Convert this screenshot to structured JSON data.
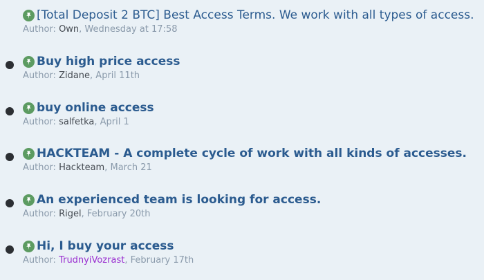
{
  "threads": [
    {
      "title": "[Total Deposit 2 BTC] Best Access Terms. We work with all types of access.",
      "author_prefix": "Author: ",
      "author": "Own",
      "date": ", Wednesday at 17:58",
      "unread": false
    },
    {
      "title": "Buy high price access",
      "author_prefix": "Author: ",
      "author": "Zidane",
      "date": ", April 11th",
      "unread": true
    },
    {
      "title": "buy online access",
      "author_prefix": "Author: ",
      "author": "salfetka",
      "date": ", April 1",
      "unread": true
    },
    {
      "title": "HACKTEAM - A complete cycle of work with all kinds of accesses.",
      "author_prefix": "Author: ",
      "author": "Hackteam",
      "date": ", March 21",
      "unread": true
    },
    {
      "title": "An experienced team is looking for access.",
      "author_prefix": "Author: ",
      "author": "Rigel",
      "date": ", February 20th",
      "unread": true
    },
    {
      "title": "Hi, I buy your access",
      "author_prefix": "Author: ",
      "author": "TrudnyiVozrast",
      "date": ", February 17th",
      "unread": true
    }
  ],
  "icons": {
    "pin": "pin-icon",
    "unread": "unread-dot"
  },
  "colors": {
    "background": "#eaf1f6",
    "title": "#2b5b8f",
    "pin_badge": "#5c9b61",
    "meta": "#8a9aab",
    "author": "#454b52",
    "special_author": "#9a2fd0",
    "unread_dot": "#2c2f33"
  }
}
